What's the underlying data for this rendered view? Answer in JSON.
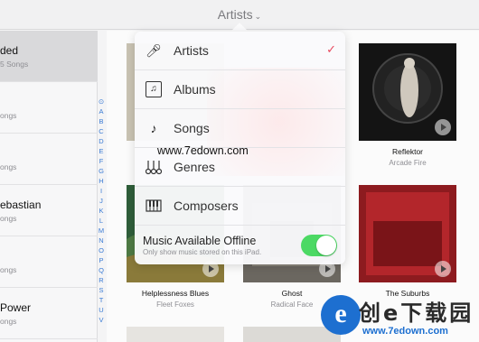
{
  "header": {
    "title": "Artists"
  },
  "left_list": [
    {
      "name": "ded",
      "sub": "5 Songs",
      "selected": true
    },
    {
      "name": "",
      "sub": "ongs",
      "selected": false
    },
    {
      "name": "",
      "sub": "ongs",
      "selected": false
    },
    {
      "name": "ebastian",
      "sub": "ongs",
      "selected": false
    },
    {
      "name": "",
      "sub": "ongs",
      "selected": false
    },
    {
      "name": "Power",
      "sub": "ongs",
      "selected": false
    }
  ],
  "index_letters": [
    "A",
    "B",
    "C",
    "D",
    "E",
    "F",
    "G",
    "H",
    "I",
    "J",
    "K",
    "L",
    "M",
    "N",
    "O",
    "P",
    "Q",
    "R",
    "S",
    "T",
    "U",
    "V"
  ],
  "albums": [
    {
      "title": "Reflektor",
      "artist": "Arcade Fire",
      "color": "#111111"
    },
    {
      "title": "Helplessness Blues",
      "artist": "Fleet Foxes",
      "color": "#3c6b45"
    },
    {
      "title": "Ghost",
      "artist": "Radical Face",
      "color": "#6f6b63"
    },
    {
      "title": "The Suburbs",
      "artist": "",
      "color": "#b2252a"
    }
  ],
  "menu": {
    "items": [
      {
        "label": "Artists",
        "icon": "microphone-icon",
        "checked": true
      },
      {
        "label": "Albums",
        "icon": "album-icon",
        "checked": false
      },
      {
        "label": "Songs",
        "icon": "music-note-icon",
        "checked": false
      },
      {
        "label": "Genres",
        "icon": "guitars-icon",
        "checked": false
      },
      {
        "label": "Composers",
        "icon": "piano-keys-icon",
        "checked": false
      }
    ],
    "offline": {
      "label": "Music Available Offline",
      "sub": "Only show music stored on this iPad.",
      "enabled": true
    }
  },
  "watermark": {
    "text1": "www.7edown.com",
    "logo_letter": "e",
    "logo_cn": "创e下载园",
    "logo_url": "www.7edown.com"
  },
  "colors": {
    "accent": "#e84a5f",
    "toggle_on": "#4cd964",
    "index_blue": "#3a7bd5"
  }
}
